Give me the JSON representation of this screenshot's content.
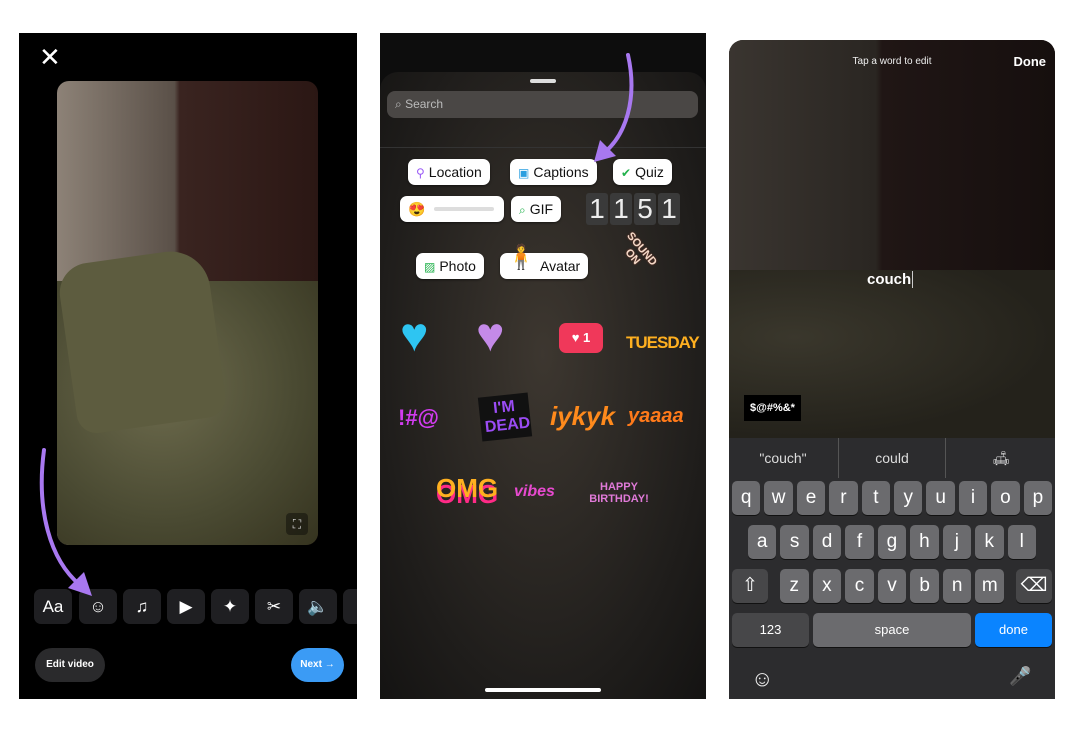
{
  "panel1": {
    "close_icon": "close-icon",
    "tools": [
      {
        "icon": "text-icon",
        "label": "Aa"
      },
      {
        "icon": "sticker-icon",
        "label": "☺"
      },
      {
        "icon": "music-add-icon",
        "label": "♫"
      },
      {
        "icon": "video-add-icon",
        "label": "▶"
      },
      {
        "icon": "sparkles-icon",
        "label": "✦"
      },
      {
        "icon": "scissors-icon",
        "label": "✂"
      },
      {
        "icon": "volume-icon",
        "label": "🔈"
      },
      {
        "icon": "more-icon",
        "label": "▯"
      }
    ],
    "edit_video": "Edit video",
    "next": "Next →",
    "accent": "#3b9bf5",
    "arrow_color": "#a878f0"
  },
  "panel2": {
    "search_placeholder": "Search",
    "chips": [
      {
        "icon": "location-pin-icon",
        "label": "Location"
      },
      {
        "icon": "captions-icon",
        "label": "Captions"
      },
      {
        "icon": "check-circle-icon",
        "label": "Quiz"
      },
      {
        "icon": "search-icon",
        "label": "GIF"
      },
      {
        "icon": "photo-icon",
        "label": "Photo"
      },
      {
        "icon": "avatar-icon",
        "label": "Avatar"
      }
    ],
    "countdown_digits": [
      "1",
      "1",
      "5",
      "1"
    ],
    "stickers": {
      "like_count": "1",
      "tuesday": "TUESDAY",
      "sound_on": "SOUND ON",
      "symbols": "!#@",
      "im_dead": "I'M DEAD",
      "iykyk": "iykyk",
      "yaaas": "yaaaa",
      "omg": "OMG",
      "vibes": "vibes",
      "birthday": "HAPPY BIRTHDAY!"
    }
  },
  "panel3": {
    "hint": "Tap a word to edit",
    "done": "Done",
    "caption_word": "couch",
    "censor": "$@#%&*",
    "suggestions": [
      "\"couch\"",
      "could",
      "🛋"
    ],
    "rows": [
      [
        "q",
        "w",
        "e",
        "r",
        "t",
        "y",
        "u",
        "i",
        "o",
        "p"
      ],
      [
        "a",
        "s",
        "d",
        "f",
        "g",
        "h",
        "j",
        "k",
        "l"
      ],
      [
        "z",
        "x",
        "c",
        "v",
        "b",
        "n",
        "m"
      ]
    ],
    "shift": "⇧",
    "delete": "⌫",
    "numbers": "123",
    "space": "space",
    "return": "done",
    "emoji": "☺",
    "mic": "🎤",
    "return_color": "#0a84ff"
  }
}
